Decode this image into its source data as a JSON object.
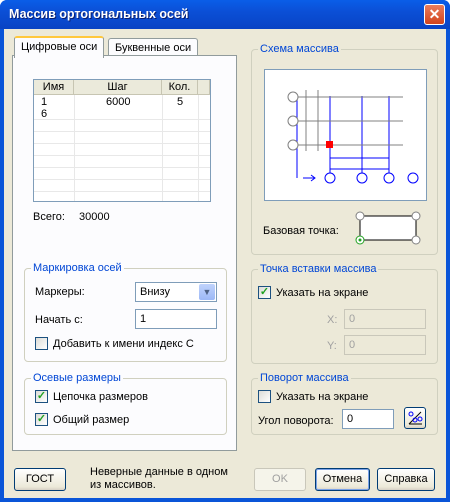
{
  "window": {
    "title": "Массив ортогональных осей"
  },
  "tabs": [
    {
      "label": "Цифровые оси",
      "active": true
    },
    {
      "label": "Буквенные оси",
      "active": false
    }
  ],
  "grid": {
    "headers": [
      "Имя",
      "Шаг",
      "Кол."
    ],
    "rows": [
      {
        "name": "1",
        "step": "6000",
        "count": "5"
      },
      {
        "name": "6",
        "step": "",
        "count": ""
      }
    ]
  },
  "total": {
    "label": "Всего:",
    "value": "30000"
  },
  "marking": {
    "title": "Маркировка осей",
    "markers_label": "Маркеры:",
    "markers_value": "Внизу",
    "start_label": "Начать с:",
    "start_value": "1",
    "add_index_label": "Добавить к имени индекс С",
    "add_index_checked": false
  },
  "dimensions": {
    "title": "Осевые размеры",
    "chain_label": "Цепочка размеров",
    "chain_checked": true,
    "total_label": "Общий размер",
    "total_checked": true
  },
  "scheme": {
    "title": "Схема массива",
    "base_point_label": "Базовая точка:"
  },
  "insertion": {
    "title": "Точка вставки массива",
    "on_screen_label": "Указать на экране",
    "on_screen_checked": true,
    "x_label": "X:",
    "x_value": "0",
    "y_label": "Y:",
    "y_value": "0"
  },
  "rotation": {
    "title": "Поворот массива",
    "on_screen_label": "Указать на экране",
    "on_screen_checked": false,
    "angle_label": "Угол поворота:",
    "angle_value": "0"
  },
  "footer": {
    "gost_label": "ГОСТ",
    "status_text": "Неверные данные в одном из массивов.",
    "ok_label": "OK",
    "cancel_label": "Отмена",
    "help_label": "Справка"
  },
  "colors": {
    "titlebar": "#0a55d8",
    "axis_lines": "#0000ff",
    "base_marker": "#ff0000",
    "group_title": "#0046d5"
  }
}
